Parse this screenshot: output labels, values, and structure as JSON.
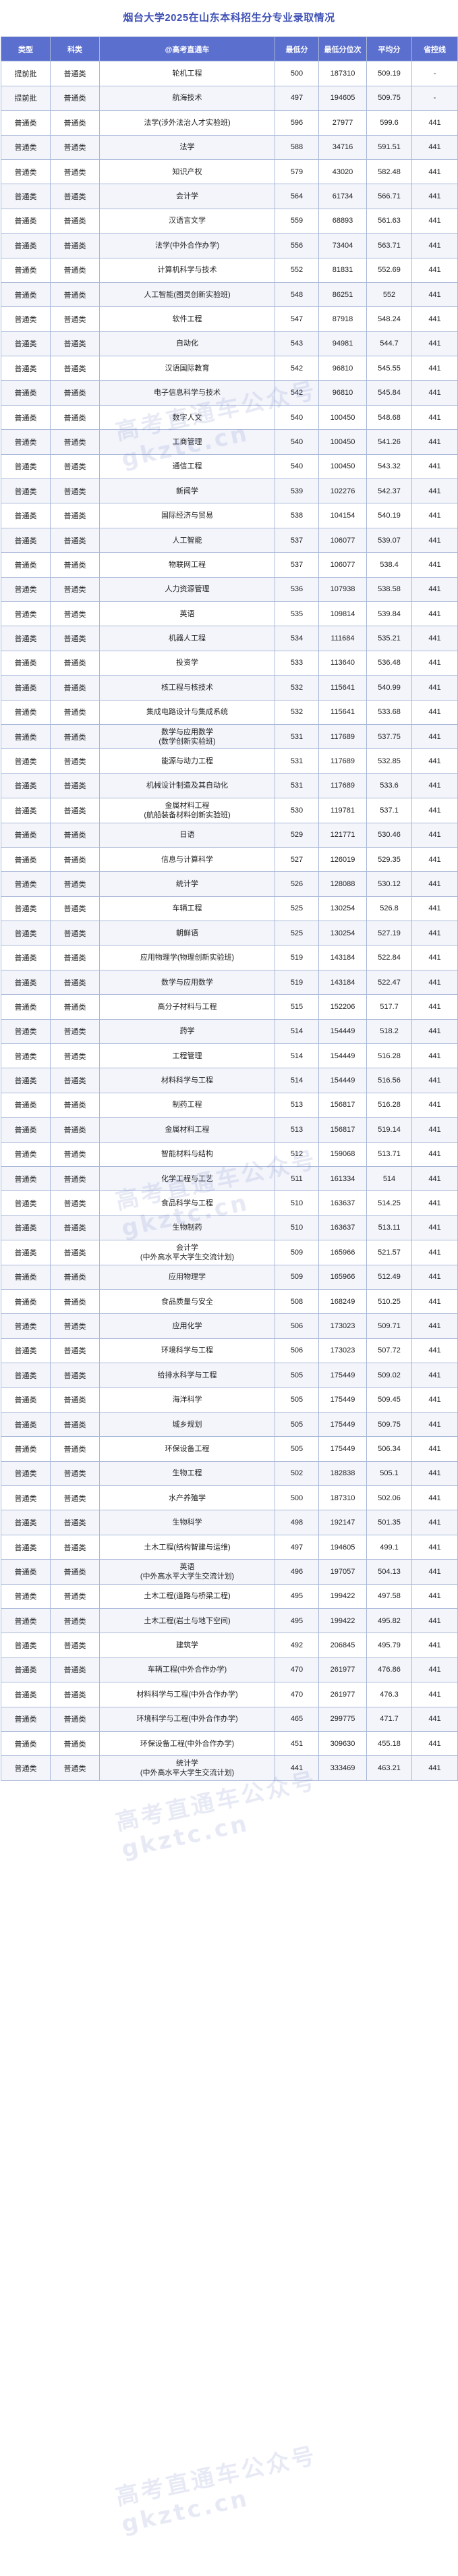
{
  "title": "烟台大学2025在山东本科招生分专业录取情况",
  "headers": [
    "类型",
    "科类",
    "@高考直通车",
    "最低分",
    "最低分位次",
    "平均分",
    "省控线"
  ],
  "watermark": "高考直通车公众号 gkztc.cn",
  "rows": [
    [
      "提前批",
      "普通类",
      "轮机工程",
      "500",
      "187310",
      "509.19",
      "-"
    ],
    [
      "提前批",
      "普通类",
      "航海技术",
      "497",
      "194605",
      "509.75",
      "-"
    ],
    [
      "普通类",
      "普通类",
      "法学(涉外法治人才实验班)",
      "596",
      "27977",
      "599.6",
      "441"
    ],
    [
      "普通类",
      "普通类",
      "法学",
      "588",
      "34716",
      "591.51",
      "441"
    ],
    [
      "普通类",
      "普通类",
      "知识产权",
      "579",
      "43020",
      "582.48",
      "441"
    ],
    [
      "普通类",
      "普通类",
      "会计学",
      "564",
      "61734",
      "566.71",
      "441"
    ],
    [
      "普通类",
      "普通类",
      "汉语言文学",
      "559",
      "68893",
      "561.63",
      "441"
    ],
    [
      "普通类",
      "普通类",
      "法学(中外合作办学)",
      "556",
      "73404",
      "563.71",
      "441"
    ],
    [
      "普通类",
      "普通类",
      "计算机科学与技术",
      "552",
      "81831",
      "552.69",
      "441"
    ],
    [
      "普通类",
      "普通类",
      "人工智能(图灵创新实验班)",
      "548",
      "86251",
      "552",
      "441"
    ],
    [
      "普通类",
      "普通类",
      "软件工程",
      "547",
      "87918",
      "548.24",
      "441"
    ],
    [
      "普通类",
      "普通类",
      "自动化",
      "543",
      "94981",
      "544.7",
      "441"
    ],
    [
      "普通类",
      "普通类",
      "汉语国际教育",
      "542",
      "96810",
      "545.55",
      "441"
    ],
    [
      "普通类",
      "普通类",
      "电子信息科学与技术",
      "542",
      "96810",
      "545.84",
      "441"
    ],
    [
      "普通类",
      "普通类",
      "数字人文",
      "540",
      "100450",
      "548.68",
      "441"
    ],
    [
      "普通类",
      "普通类",
      "工商管理",
      "540",
      "100450",
      "541.26",
      "441"
    ],
    [
      "普通类",
      "普通类",
      "通信工程",
      "540",
      "100450",
      "543.32",
      "441"
    ],
    [
      "普通类",
      "普通类",
      "新闻学",
      "539",
      "102276",
      "542.37",
      "441"
    ],
    [
      "普通类",
      "普通类",
      "国际经济与贸易",
      "538",
      "104154",
      "540.19",
      "441"
    ],
    [
      "普通类",
      "普通类",
      "人工智能",
      "537",
      "106077",
      "539.07",
      "441"
    ],
    [
      "普通类",
      "普通类",
      "物联网工程",
      "537",
      "106077",
      "538.4",
      "441"
    ],
    [
      "普通类",
      "普通类",
      "人力资源管理",
      "536",
      "107938",
      "538.58",
      "441"
    ],
    [
      "普通类",
      "普通类",
      "英语",
      "535",
      "109814",
      "539.84",
      "441"
    ],
    [
      "普通类",
      "普通类",
      "机器人工程",
      "534",
      "111684",
      "535.21",
      "441"
    ],
    [
      "普通类",
      "普通类",
      "投资学",
      "533",
      "113640",
      "536.48",
      "441"
    ],
    [
      "普通类",
      "普通类",
      "核工程与核技术",
      "532",
      "115641",
      "540.99",
      "441"
    ],
    [
      "普通类",
      "普通类",
      "集成电路设计与集成系统",
      "532",
      "115641",
      "533.68",
      "441"
    ],
    [
      "普通类",
      "普通类",
      "数学与应用数学\n(数学创新实验班)",
      "531",
      "117689",
      "537.75",
      "441"
    ],
    [
      "普通类",
      "普通类",
      "能源与动力工程",
      "531",
      "117689",
      "532.85",
      "441"
    ],
    [
      "普通类",
      "普通类",
      "机械设计制造及其自动化",
      "531",
      "117689",
      "533.6",
      "441"
    ],
    [
      "普通类",
      "普通类",
      "金属材料工程\n(航船装备材料创新实验班)",
      "530",
      "119781",
      "537.1",
      "441"
    ],
    [
      "普通类",
      "普通类",
      "日语",
      "529",
      "121771",
      "530.46",
      "441"
    ],
    [
      "普通类",
      "普通类",
      "信息与计算科学",
      "527",
      "126019",
      "529.35",
      "441"
    ],
    [
      "普通类",
      "普通类",
      "统计学",
      "526",
      "128088",
      "530.12",
      "441"
    ],
    [
      "普通类",
      "普通类",
      "车辆工程",
      "525",
      "130254",
      "526.8",
      "441"
    ],
    [
      "普通类",
      "普通类",
      "朝鲜语",
      "525",
      "130254",
      "527.19",
      "441"
    ],
    [
      "普通类",
      "普通类",
      "应用物理学(物理创新实验班)",
      "519",
      "143184",
      "522.84",
      "441"
    ],
    [
      "普通类",
      "普通类",
      "数学与应用数学",
      "519",
      "143184",
      "522.47",
      "441"
    ],
    [
      "普通类",
      "普通类",
      "高分子材料与工程",
      "515",
      "152206",
      "517.7",
      "441"
    ],
    [
      "普通类",
      "普通类",
      "药学",
      "514",
      "154449",
      "518.2",
      "441"
    ],
    [
      "普通类",
      "普通类",
      "工程管理",
      "514",
      "154449",
      "516.28",
      "441"
    ],
    [
      "普通类",
      "普通类",
      "材料科学与工程",
      "514",
      "154449",
      "516.56",
      "441"
    ],
    [
      "普通类",
      "普通类",
      "制药工程",
      "513",
      "156817",
      "516.28",
      "441"
    ],
    [
      "普通类",
      "普通类",
      "金属材料工程",
      "513",
      "156817",
      "519.14",
      "441"
    ],
    [
      "普通类",
      "普通类",
      "智能材料与结构",
      "512",
      "159068",
      "513.71",
      "441"
    ],
    [
      "普通类",
      "普通类",
      "化学工程与工艺",
      "511",
      "161334",
      "514",
      "441"
    ],
    [
      "普通类",
      "普通类",
      "食品科学与工程",
      "510",
      "163637",
      "514.25",
      "441"
    ],
    [
      "普通类",
      "普通类",
      "生物制药",
      "510",
      "163637",
      "513.11",
      "441"
    ],
    [
      "普通类",
      "普通类",
      "会计学\n(中外高水平大学生交流计划)",
      "509",
      "165966",
      "521.57",
      "441"
    ],
    [
      "普通类",
      "普通类",
      "应用物理学",
      "509",
      "165966",
      "512.49",
      "441"
    ],
    [
      "普通类",
      "普通类",
      "食品质量与安全",
      "508",
      "168249",
      "510.25",
      "441"
    ],
    [
      "普通类",
      "普通类",
      "应用化学",
      "506",
      "173023",
      "509.71",
      "441"
    ],
    [
      "普通类",
      "普通类",
      "环境科学与工程",
      "506",
      "173023",
      "507.72",
      "441"
    ],
    [
      "普通类",
      "普通类",
      "给排水科学与工程",
      "505",
      "175449",
      "509.02",
      "441"
    ],
    [
      "普通类",
      "普通类",
      "海洋科学",
      "505",
      "175449",
      "509.45",
      "441"
    ],
    [
      "普通类",
      "普通类",
      "城乡规划",
      "505",
      "175449",
      "509.75",
      "441"
    ],
    [
      "普通类",
      "普通类",
      "环保设备工程",
      "505",
      "175449",
      "506.34",
      "441"
    ],
    [
      "普通类",
      "普通类",
      "生物工程",
      "502",
      "182838",
      "505.1",
      "441"
    ],
    [
      "普通类",
      "普通类",
      "水产养殖学",
      "500",
      "187310",
      "502.06",
      "441"
    ],
    [
      "普通类",
      "普通类",
      "生物科学",
      "498",
      "192147",
      "501.35",
      "441"
    ],
    [
      "普通类",
      "普通类",
      "土木工程(结构智建与运维)",
      "497",
      "194605",
      "499.1",
      "441"
    ],
    [
      "普通类",
      "普通类",
      "英语\n(中外高水平大学生交流计划)",
      "496",
      "197057",
      "504.13",
      "441"
    ],
    [
      "普通类",
      "普通类",
      "土木工程(道路与桥梁工程)",
      "495",
      "199422",
      "497.58",
      "441"
    ],
    [
      "普通类",
      "普通类",
      "土木工程(岩土与地下空间)",
      "495",
      "199422",
      "495.82",
      "441"
    ],
    [
      "普通类",
      "普通类",
      "建筑学",
      "492",
      "206845",
      "495.79",
      "441"
    ],
    [
      "普通类",
      "普通类",
      "车辆工程(中外合作办学)",
      "470",
      "261977",
      "476.86",
      "441"
    ],
    [
      "普通类",
      "普通类",
      "材料科学与工程(中外合作办学)",
      "470",
      "261977",
      "476.3",
      "441"
    ],
    [
      "普通类",
      "普通类",
      "环境科学与工程(中外合作办学)",
      "465",
      "299775",
      "471.7",
      "441"
    ],
    [
      "普通类",
      "普通类",
      "环保设备工程(中外合作办学)",
      "451",
      "309630",
      "455.18",
      "441"
    ],
    [
      "普通类",
      "普通类",
      "统计学\n(中外高水平大学生交流计划)",
      "441",
      "333469",
      "463.21",
      "441"
    ]
  ]
}
